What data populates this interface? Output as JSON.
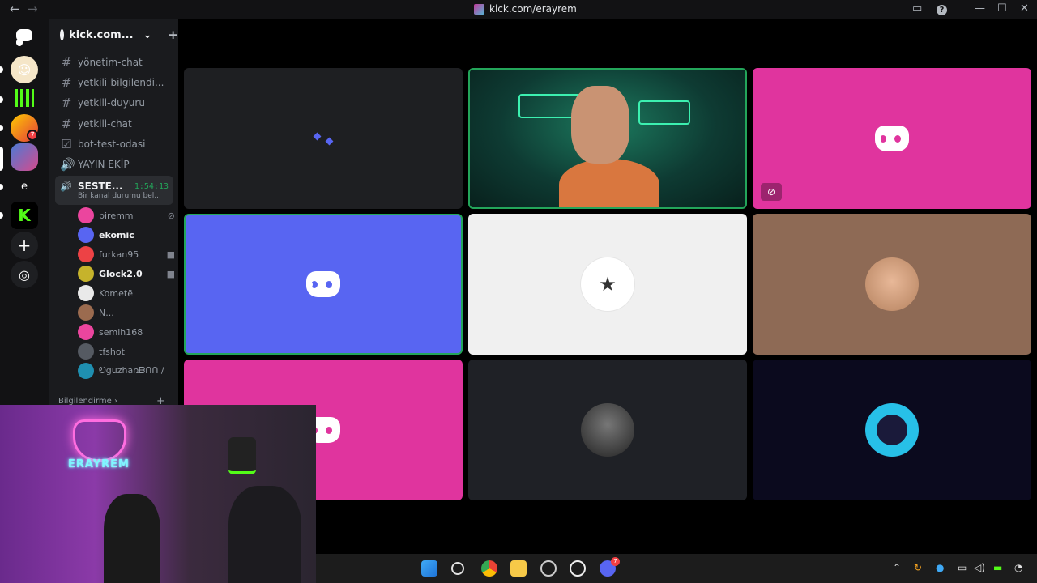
{
  "titlebar": {
    "url": "kick.com/erayrem",
    "back": "←",
    "forward": "→",
    "inbox": "▭",
    "help": "?",
    "minimize": "—",
    "maximize": "☐",
    "close": "✕"
  },
  "servers": {
    "add_label": "+",
    "explore_label": "◎",
    "dm_label": "e",
    "badge_count": "7"
  },
  "server_header": {
    "name": "kick.com...",
    "chevron": "⌄",
    "invite": "+"
  },
  "channels": [
    {
      "icon": "#",
      "label": "yönetim-chat"
    },
    {
      "icon": "#",
      "label": "yetkili-bilgilendi..."
    },
    {
      "icon": "#",
      "label": "yetkili-duyuru"
    },
    {
      "icon": "#",
      "label": "yetkili-chat"
    },
    {
      "icon": "☑",
      "label": "bot-test-odasi"
    },
    {
      "icon": "🔊",
      "label": "YAYIN EKİP"
    }
  ],
  "active_voice": {
    "label": "SESTE...",
    "timer": "1:54:13",
    "status": "Bir kanal durumu bel..."
  },
  "voice_users": [
    {
      "name": "biremm",
      "color": "#eb459e",
      "muted": true
    },
    {
      "name": "ekomic",
      "color": "#5865f2",
      "bold": true
    },
    {
      "name": "furkan95",
      "color": "#ed4245",
      "video": true
    },
    {
      "name": "Glock2.0",
      "color": "#c6b32b",
      "bold": true,
      "video": true
    },
    {
      "name": "Kometë",
      "color": "#e9e9e9"
    },
    {
      "name": "N...",
      "color": "#9b6b4f"
    },
    {
      "name": "semih168",
      "color": "#eb459e"
    },
    {
      "name": "tfshot",
      "color": "#555a62"
    },
    {
      "name": "Ꭷցuzhaռᗷᑎᑎ /",
      "color": "#1f8fb0"
    }
  ],
  "category": {
    "label": "Bilgilendirme ›",
    "add": "+"
  },
  "tiles": [
    {
      "id": "loading",
      "bg": "#1e1f22"
    },
    {
      "id": "streamer",
      "bg": "#0d3a34",
      "speaking": true
    },
    {
      "id": "pink-1",
      "bg": "#e0349e",
      "muted": true
    },
    {
      "id": "blurple",
      "bg": "#5865f2",
      "speaking": true
    },
    {
      "id": "kometa",
      "bg": "#f0f0f0"
    },
    {
      "id": "face",
      "bg": "#8e6a55"
    },
    {
      "id": "pink-2",
      "bg": "#e0349e"
    },
    {
      "id": "tfshot",
      "bg": "#1f2126"
    },
    {
      "id": "oguzhan",
      "bg": "#0b0a1e"
    }
  ],
  "webcam": {
    "sign": "ERAYREM"
  },
  "taskbar": {
    "notify_count": "7"
  },
  "colors": {
    "discord_blurple": "#5865f2",
    "speaking_green": "#23a55a",
    "pink": "#e0349e"
  }
}
